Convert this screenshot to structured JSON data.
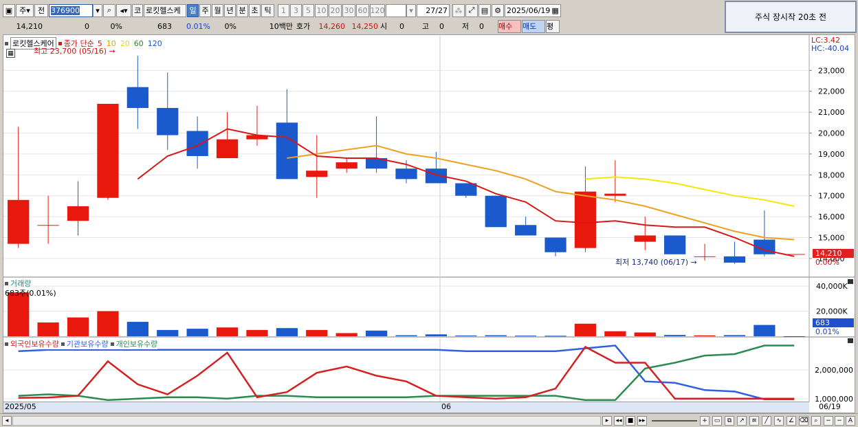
{
  "toolbar": {
    "unit": "주",
    "compare": "전",
    "code": "376900",
    "market_btn": "코",
    "stock_name": "로킷헬스케",
    "periods": [
      "일",
      "주",
      "월",
      "년",
      "분",
      "초",
      "틱"
    ],
    "selected_period": "일",
    "intervals": [
      "1",
      "3",
      "5",
      "10",
      "20",
      "30",
      "60",
      "120"
    ],
    "count": "27",
    "count_total": "/27",
    "date": "2025/06/19"
  },
  "quote": {
    "price": "14,210",
    "change": "0",
    "change_pct": "0%",
    "volume": "683",
    "volume_pct": "0.01%",
    "extra_pct": "0%",
    "unit_label": "10백만",
    "ask_label": "호가",
    "ask": "14,260",
    "bid": "14,250",
    "open_label": "시",
    "open": "0",
    "high_label": "고",
    "high": "0",
    "low_label": "저",
    "low": "0",
    "buy_btn": "매수",
    "sell_btn": "매도",
    "eval_btn": "평"
  },
  "notice": "주식 장시작 20초 전",
  "price_panel": {
    "legend_name": "로킷헬스케어",
    "legend_label": "종가 단순",
    "ma_labels": [
      "5",
      "10",
      "20",
      "60",
      "120"
    ],
    "ma_colors": [
      "#e81010",
      "#e6b400",
      "#f0e000",
      "#2a8a2a",
      "#1a58c8"
    ],
    "high_note": "최고 23,700 (05/16)",
    "low_note": "최저 13,740 (06/17)",
    "lc": "LC:3.42",
    "hc": "HC:-40.04",
    "y_ticks": [
      "23,000",
      "22,000",
      "21,000",
      "20,000",
      "19,000",
      "18,000",
      "17,000",
      "16,000",
      "15,000",
      "14,000"
    ],
    "last_price": "14,210",
    "last_pct": "0.00%"
  },
  "volume_panel": {
    "title": "거래량",
    "note": "683주(0.01%)",
    "y_ticks": [
      "40,000K",
      "20,000K"
    ],
    "last_value": "683",
    "last_pct": "0.01%"
  },
  "holder_panel": {
    "legend": [
      "외국인보유수량",
      "기관보유수량",
      "개인보유수량"
    ],
    "colors": [
      "#d42020",
      "#3060e0",
      "#2a8a50"
    ],
    "y_ticks": [
      "2,000,000",
      "1,000,000"
    ]
  },
  "x_axis": {
    "labels": [
      "2025/05",
      "06",
      "06/19"
    ]
  },
  "chart_data": {
    "type": "candlestick",
    "candles": [
      {
        "o": 14700,
        "h": 20300,
        "l": 14500,
        "c": 16800
      },
      {
        "o": 15600,
        "h": 17000,
        "l": 14700,
        "c": 15600
      },
      {
        "o": 15800,
        "h": 17700,
        "l": 15100,
        "c": 16500
      },
      {
        "o": 16900,
        "h": 17100,
        "l": 16800,
        "c": 21400
      },
      {
        "o": 22200,
        "h": 23700,
        "l": 20200,
        "c": 21200
      },
      {
        "o": 21200,
        "h": 22900,
        "l": 19200,
        "c": 19900
      },
      {
        "o": 20100,
        "h": 20800,
        "l": 18300,
        "c": 18900
      },
      {
        "o": 18800,
        "h": 21000,
        "l": 18800,
        "c": 19700
      },
      {
        "o": 19700,
        "h": 21300,
        "l": 19400,
        "c": 19900
      },
      {
        "o": 20500,
        "h": 22100,
        "l": 17800,
        "c": 17800
      },
      {
        "o": 17900,
        "h": 19900,
        "l": 16900,
        "c": 18200
      },
      {
        "o": 18300,
        "h": 18800,
        "l": 18100,
        "c": 18600
      },
      {
        "o": 18800,
        "h": 20800,
        "l": 18100,
        "c": 18300
      },
      {
        "o": 18300,
        "h": 18700,
        "l": 17600,
        "c": 17800
      },
      {
        "o": 18300,
        "h": 19100,
        "l": 17700,
        "c": 17600
      },
      {
        "o": 17600,
        "h": 17600,
        "l": 16900,
        "c": 17000
      },
      {
        "o": 17000,
        "h": 17000,
        "l": 15500,
        "c": 15500
      },
      {
        "o": 15600,
        "h": 16000,
        "l": 15100,
        "c": 15100
      },
      {
        "o": 15000,
        "h": 15000,
        "l": 14100,
        "c": 14300
      },
      {
        "o": 14500,
        "h": 18400,
        "l": 14300,
        "c": 17200
      },
      {
        "o": 17000,
        "h": 18700,
        "l": 16700,
        "c": 17100
      },
      {
        "o": 14800,
        "h": 16000,
        "l": 14400,
        "c": 15100
      },
      {
        "o": 15100,
        "h": 15100,
        "l": 14200,
        "c": 14200
      },
      {
        "o": 14100,
        "h": 14700,
        "l": 13900,
        "c": 14100
      },
      {
        "o": 14100,
        "h": 14800,
        "l": 13740,
        "c": 13800
      },
      {
        "o": 14900,
        "h": 16300,
        "l": 14100,
        "c": 14200
      },
      {
        "o": 14210,
        "h": 14210,
        "l": 14210,
        "c": 14210
      }
    ],
    "ma5": [
      null,
      null,
      null,
      null,
      17800,
      18900,
      19400,
      20200,
      19900,
      19800,
      18900,
      18800,
      18800,
      18500,
      18000,
      17700,
      17100,
      16700,
      15800,
      15700,
      15800,
      15600,
      15500,
      15500,
      15000,
      14400,
      14100
    ],
    "ma10": [
      null,
      null,
      null,
      null,
      null,
      null,
      null,
      null,
      null,
      18800,
      19000,
      19200,
      19400,
      19000,
      18800,
      18500,
      18200,
      17800,
      17200,
      17000,
      16800,
      16500,
      16100,
      15700,
      15300,
      15000,
      14900
    ],
    "ma20": [
      null,
      null,
      null,
      null,
      null,
      null,
      null,
      null,
      null,
      null,
      null,
      null,
      null,
      null,
      null,
      null,
      null,
      null,
      null,
      17800,
      17900,
      17800,
      17600,
      17300,
      17000,
      16800,
      16500
    ],
    "volume_k": [
      35000,
      11000,
      15000,
      20000,
      11500,
      5000,
      6000,
      7000,
      5000,
      6500,
      5000,
      2500,
      4500,
      800,
      1500,
      600,
      800,
      500,
      400,
      10000,
      4000,
      3000,
      1000,
      700,
      900,
      9000,
      1
    ],
    "foreign_holdings": [
      1030000,
      1040000,
      1100000,
      2300000,
      1500000,
      1150000,
      1800000,
      2600000,
      1050000,
      1230000,
      1900000,
      2120000,
      1800000,
      1600000,
      1100000,
      1050000,
      1000000,
      1050000,
      1350000,
      2800000,
      2250000,
      2250000,
      1000000,
      1000000,
      1000000,
      1000000,
      1000000
    ],
    "inst_holdings": [
      2650000,
      2700000,
      2700000,
      2700000,
      2700000,
      2700000,
      2700000,
      2700000,
      2700000,
      2700000,
      2700000,
      2700000,
      2700000,
      2700000,
      2700000,
      2650000,
      2650000,
      2650000,
      2650000,
      2750000,
      2850000,
      1600000,
      1550000,
      1300000,
      1250000,
      980000,
      980000
    ],
    "retail_holdings": [
      1100000,
      1150000,
      1100000,
      950000,
      1000000,
      1050000,
      1050000,
      1000000,
      1100000,
      1100000,
      1050000,
      1050000,
      1050000,
      1050000,
      1100000,
      1100000,
      1100000,
      1100000,
      1100000,
      950000,
      950000,
      2050000,
      2250000,
      2500000,
      2550000,
      2850000,
      2850000
    ],
    "ylim_price": [
      13700,
      23900
    ],
    "ylim_volume": [
      0,
      45000
    ],
    "ylim_holdings": [
      900000,
      3100000
    ]
  }
}
